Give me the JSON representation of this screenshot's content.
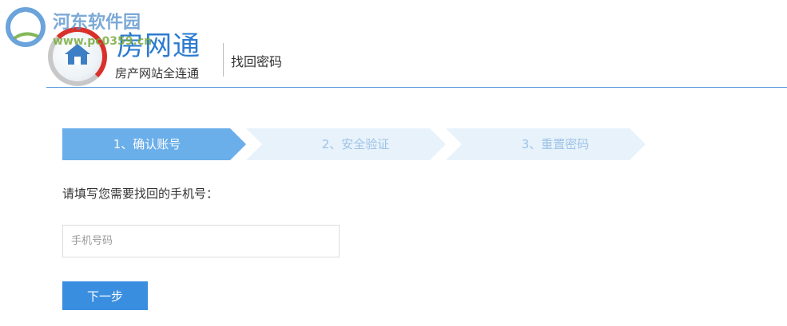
{
  "watermark": {
    "title": "河东软件园",
    "url": "www.pc0359.cn"
  },
  "logo": {
    "name": "房网通",
    "tagline": "房产网站全连通"
  },
  "header": {
    "title": "找回密码"
  },
  "steps": [
    {
      "label": "1、确认账号",
      "active": true
    },
    {
      "label": "2、安全验证",
      "active": false
    },
    {
      "label": "3、重置密码",
      "active": false
    }
  ],
  "form": {
    "prompt": "请填写您需要找回的手机号：",
    "phone_placeholder": "手机号码",
    "phone_value": "",
    "next_label": "下一步"
  },
  "colors": {
    "accent": "#3a8ee0",
    "step_active": "#6aaeea",
    "step_inactive": "#e8f2fb",
    "header_line": "#4d95d6"
  }
}
